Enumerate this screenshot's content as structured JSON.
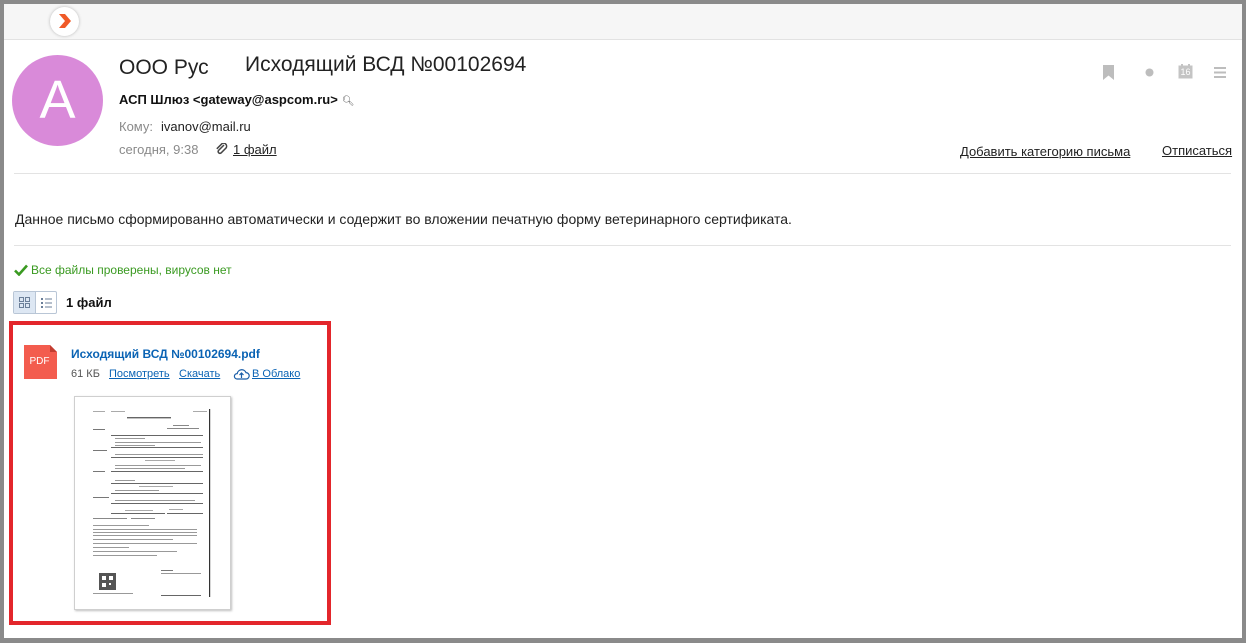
{
  "header": {
    "sender_name": "ООО Рус",
    "subject": "Исходящий ВСД №00102694",
    "avatar_letter": "A",
    "avatar_color": "#d98ad9",
    "from": "АСП Шлюз <gateway@aspcom.ru>",
    "to_label": "Кому:",
    "to_value": "ivanov@mail.ru",
    "date": "сегодня, 9:38",
    "files_link": "1 файл",
    "add_category": "Добавить категорию письма",
    "unsubscribe": "Отписаться",
    "calendar_day": "16"
  },
  "body": {
    "text": "Данное письмо сформированно автоматически и содержит во вложении печатную форму ветеринарного сертификата."
  },
  "attachments": {
    "virus_status": "Все файлы проверены, вирусов нет",
    "count_label": "1 файл",
    "file": {
      "name": "Исходящий ВСД №00102694.pdf",
      "size": "61 КБ",
      "view_label": "Посмотреть",
      "download_label": "Скачать",
      "cloud_label": "В Облако",
      "icon_label": "PDF"
    }
  },
  "colors": {
    "link": "#0a63b4",
    "virus_ok": "#3a9a21",
    "highlight_box": "#e3262b",
    "pdf_icon": "#f35c4e"
  }
}
